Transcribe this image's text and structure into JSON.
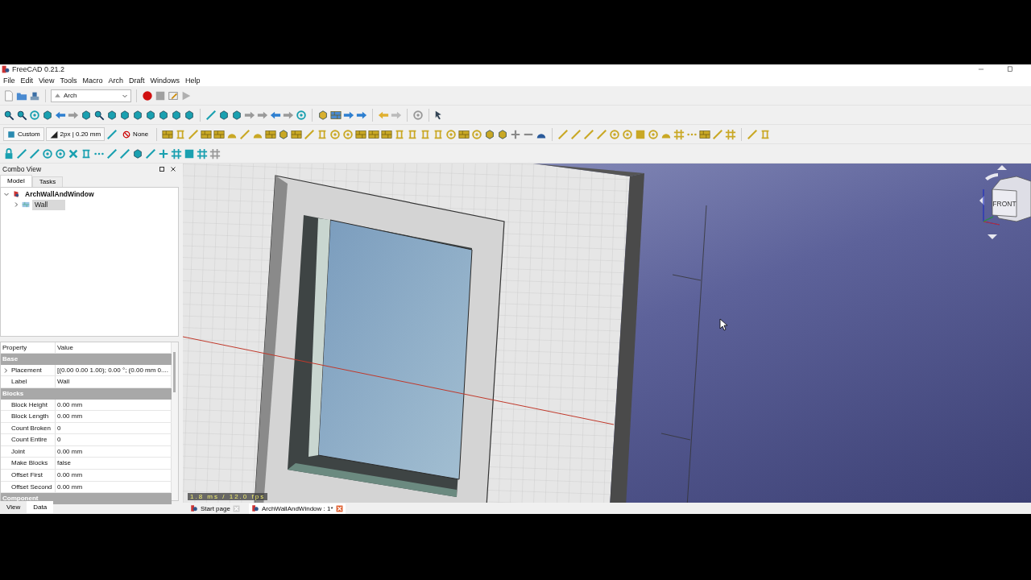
{
  "window": {
    "title": "FreeCAD 0.21.2"
  },
  "menu": [
    "File",
    "Edit",
    "View",
    "Tools",
    "Macro",
    "Arch",
    "Draft",
    "Windows",
    "Help"
  ],
  "workbench": {
    "value": "Arch"
  },
  "draft_tray": {
    "style": "Custom",
    "line": "2px | 0.20 mm",
    "snap": "None"
  },
  "combo_view": {
    "title": "Combo View",
    "tabs": [
      {
        "label": "Model",
        "selected": true
      },
      {
        "label": "Tasks",
        "selected": false
      }
    ],
    "tree": [
      {
        "label": "ArchWallAndWindow",
        "expanded": true,
        "selected": false,
        "children": [
          {
            "label": "Wall",
            "expanded": false,
            "selected": true
          }
        ]
      }
    ]
  },
  "properties": {
    "columns": [
      "Property",
      "Value"
    ],
    "groups": [
      {
        "name": "Base",
        "rows": [
          {
            "name": "Placement",
            "value": "[(0.00 0.00 1.00); 0.00 °; (0.00 mm  0....",
            "expandable": true
          },
          {
            "name": "Label",
            "value": "Wall",
            "expandable": false
          }
        ]
      },
      {
        "name": "Blocks",
        "rows": [
          {
            "name": "Block Height",
            "value": "0.00 mm",
            "expandable": false
          },
          {
            "name": "Block Length",
            "value": "0.00 mm",
            "expandable": false
          },
          {
            "name": "Count Broken",
            "value": "0",
            "expandable": false
          },
          {
            "name": "Count Entire",
            "value": "0",
            "expandable": false
          },
          {
            "name": "Joint",
            "value": "0.00 mm",
            "expandable": false
          },
          {
            "name": "Make Blocks",
            "value": "false",
            "expandable": false
          },
          {
            "name": "Offset First",
            "value": "0.00 mm",
            "expandable": false
          },
          {
            "name": "Offset Second",
            "value": "0.00 mm",
            "expandable": false
          }
        ]
      },
      {
        "name": "Component"
      }
    ]
  },
  "panel_tabs": [
    {
      "label": "View",
      "selected": false
    },
    {
      "label": "Data",
      "selected": true
    }
  ],
  "viewport": {
    "fps": "1.8 ms / 12.0 fps",
    "cube_face": "FRONT"
  },
  "doc_tabs": [
    {
      "label": "Start page",
      "selected": false
    },
    {
      "label": "ArchWallAndWindow : 1*",
      "selected": true
    }
  ]
}
